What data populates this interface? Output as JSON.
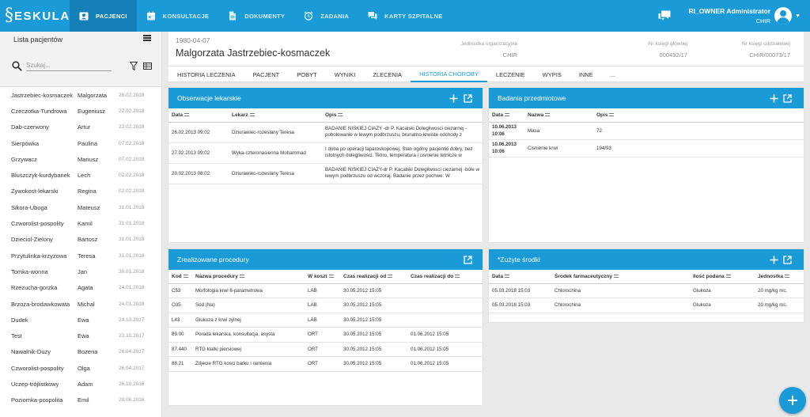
{
  "app": {
    "logo_mark": "§",
    "logo_text": "ESKULAP"
  },
  "nav": [
    {
      "label": "PACJENCI",
      "icon": "person-badge-icon",
      "active": true
    },
    {
      "label": "KONSULTACJE",
      "icon": "calendar-icon",
      "active": false
    },
    {
      "label": "DOKUMENTY",
      "icon": "document-icon",
      "active": false
    },
    {
      "label": "ZADANIA",
      "icon": "alarm-icon",
      "active": false
    },
    {
      "label": "KARTY SZPITALNE",
      "icon": "chat-cards-icon",
      "active": false
    }
  ],
  "user": {
    "name": "RI_OWNER Administrator",
    "unit": "CHIR"
  },
  "sidebar": {
    "title": "Lista pacjentów",
    "search_placeholder": "Szukaj...",
    "patients": [
      {
        "last": "Jastrzebiec-kosmaczek",
        "first": "Malgorzata",
        "date": "28.02.2018"
      },
      {
        "last": "Czeczotka-Tundrowa",
        "first": "Eugeniusz",
        "date": "22.02.2018"
      },
      {
        "last": "Dab-czerwony",
        "first": "Artur",
        "date": "22.02.2018"
      },
      {
        "last": "Sierpówka",
        "first": "Paulina",
        "date": "07.02.2018"
      },
      {
        "last": "Grzywacz",
        "first": "Mariusz",
        "date": "07.02.2018"
      },
      {
        "last": "Bluszczyk-kurdybanek",
        "first": "Lech",
        "date": "02.02.2018"
      },
      {
        "last": "Zywokost-lekarski",
        "first": "Regina",
        "date": "02.02.2018"
      },
      {
        "last": "Sikora-Uboga",
        "first": "Mateusz",
        "date": "31.01.2018"
      },
      {
        "last": "Czworolist-pospolity",
        "first": "Kamil",
        "date": "31.01.2018"
      },
      {
        "last": "Dzieciol-Zielony",
        "first": "Bartosz",
        "date": "31.01.2018"
      },
      {
        "last": "Przytulinka-krzyzowa",
        "first": "Teresa",
        "date": "31.01.2018"
      },
      {
        "last": "Tomka-wonna",
        "first": "Jan",
        "date": "30.01.2018"
      },
      {
        "last": "Rzezucha-gorzka",
        "first": "Agata",
        "date": "24.01.2018"
      },
      {
        "last": "Brzoza-brodawkowata",
        "first": "Michal",
        "date": "24.01.2018"
      },
      {
        "last": "Dudek",
        "first": "Ewa",
        "date": "24.10.2017"
      },
      {
        "last": "Test",
        "first": "Ewa",
        "date": "23.10.2017"
      },
      {
        "last": "Nawalnik-Duzy",
        "first": "Bozena",
        "date": "26.04.2017"
      },
      {
        "last": "Czworolist-pospolity",
        "first": "Olga",
        "date": "26.04.2017"
      },
      {
        "last": "Uczep-trójlistkowy",
        "first": "Adam",
        "date": "26.10.2016"
      },
      {
        "last": "Poziomka-pospolita",
        "first": "Emil",
        "date": "20.06.2016"
      }
    ]
  },
  "patient": {
    "dob": "1980-04-07",
    "name": "Malgorzata Jastrzebiec-kosmaczek",
    "unit_label": "Jednostka organizacyjna",
    "unit_value": "CHIR",
    "main_book_label": "Nr księgi głównej",
    "main_book_value": "000492/17",
    "ward_book_label": "Nr księgi oddziałowej",
    "ward_book_value": "CHIR/00073/17"
  },
  "tabs": [
    "HISTORIA LECZENIA",
    "PACJENT",
    "POBYT",
    "WYNIKI",
    "ZLECENIA",
    "HISTORIA CHOROBY",
    "LECZENIE",
    "WYPIS",
    "INNE",
    "..."
  ],
  "active_tab": 5,
  "observations": {
    "title": "Obserwacje lekarskie",
    "headers": [
      "Data",
      "Lekarz",
      "Opis"
    ],
    "rows": [
      {
        "date": "26.02.2013 09:02",
        "doctor": "Dziurawiec-rozeslany Teresa",
        "desc": "BADANIE NISKIEJ CIAZY -dr P. Kacalski Dolegliwosci ciezarnej -pobolewanie w lewym podbrzuszu, brunatno-krwiste odchody z"
      },
      {
        "date": "27.02.2013 09:02",
        "doctor": "Wyka-czteronasienna Mohammad",
        "desc": "I doba po operacji laparoskopowej. Stan ogólny pacjentki dobry, bez istotnych dolegliwości. Tetno, temperatura i cisnienie tetnicze w"
      },
      {
        "date": "20.02.2013 08:02",
        "doctor": "Dziurawiec-rozeslany Teresa",
        "desc": "BADANIE NISKIEJ CIAZY-dr P. Kacalski Dolegliwosci ciezarnej -bóle w lewym podbrzuszu od wczoraj. Badanie przez pochwe: W"
      }
    ]
  },
  "exams": {
    "title": "Badania przedmiotowe",
    "headers": [
      "Data",
      "Nazwa",
      "Opis"
    ],
    "rows": [
      {
        "date": "10.06.2013",
        "time": "10:06",
        "name": "Masa",
        "desc": "72"
      },
      {
        "date": "10.06.2013",
        "time": "10:06",
        "name": "Cisnienie krwi",
        "desc": "194/93"
      }
    ]
  },
  "procedures": {
    "title": "Zrealizowane procedury",
    "headers": [
      "Kod",
      "Nazwa procedury",
      "W koszt",
      "Czas realizacji od",
      "Czas realizacji do"
    ],
    "rows": [
      {
        "code": "C53",
        "name": "Morfologia krwi 8-parametrowa",
        "cost": "LAB",
        "from": "30.05.2012 15:05",
        "to": ""
      },
      {
        "code": "O35",
        "name": "Sód (Na)",
        "cost": "LAB",
        "from": "30.05.2012 15:05",
        "to": ""
      },
      {
        "code": "L43",
        "name": "Glukoza z krwi zylnej",
        "cost": "LAB",
        "from": "30.05.2012 15:05",
        "to": ""
      },
      {
        "code": "89.00",
        "name": "Porada lekarska, konsultacja, asysta",
        "cost": "ORT",
        "from": "30.05.2012 15:05",
        "to": "01.06.2012 15:05"
      },
      {
        "code": "87.440",
        "name": "RTG klatki piersiowej",
        "cost": "ORT",
        "from": "30.05.2012 15:05",
        "to": "01.06.2012 15:05"
      },
      {
        "code": "88.21",
        "name": "Zdjecie RTG kosci barku i ramienia",
        "cost": "ORT",
        "from": "30.05.2012 15:05",
        "to": "01.06.2012 15:05"
      }
    ]
  },
  "drugs": {
    "title": "*Zużyte środki",
    "headers": [
      "Data",
      "Środek farmaceutyczny",
      "Ilość podana",
      "Jednostka"
    ],
    "rows": [
      {
        "date": "05.03.2018 15:03",
        "name": "Chlorochina",
        "amount": "Glukoza",
        "unit": "20 mg/kg mc."
      },
      {
        "date": "05.03.2018 15:03",
        "name": "Chlorochina",
        "amount": "Glukoza",
        "unit": "20 mg/kg mc."
      }
    ]
  }
}
